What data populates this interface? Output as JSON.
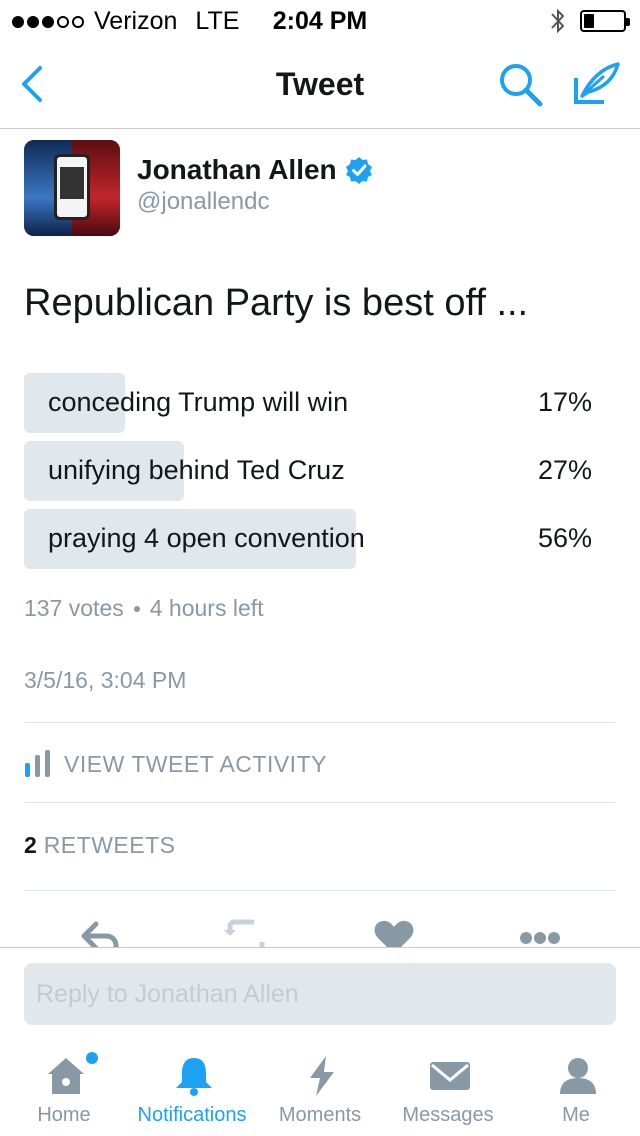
{
  "status_bar": {
    "carrier": "Verizon",
    "network": "LTE",
    "time": "2:04 PM",
    "signal_bars_filled": 3,
    "signal_bars_total": 5
  },
  "nav": {
    "title": "Tweet",
    "icons": [
      "chevron-left-icon",
      "search-icon",
      "compose-icon"
    ]
  },
  "tweet": {
    "author": {
      "name": "Jonathan Allen",
      "handle": "@jonallendc",
      "verified": true
    },
    "text": "Republican Party is best off ...",
    "poll": {
      "options": [
        {
          "label": "conceding Trump will win",
          "percent_text": "17%",
          "percent": 17
        },
        {
          "label": "unifying behind Ted Cruz",
          "percent_text": "27%",
          "percent": 27
        },
        {
          "label": "praying 4 open convention",
          "percent_text": "56%",
          "percent": 56
        }
      ],
      "votes": "137 votes",
      "time_left": "4 hours left"
    },
    "timestamp": "3/5/16, 3:04 PM",
    "activity_label": "VIEW TWEET ACTIVITY",
    "retweets_count": "2",
    "retweets_label": "RETWEETS"
  },
  "reply": {
    "placeholder": "Reply to Jonathan Allen"
  },
  "tabbar": {
    "items": [
      {
        "label": "Home",
        "icon": "home-icon",
        "active": false
      },
      {
        "label": "Notifications",
        "icon": "bell-icon",
        "active": true
      },
      {
        "label": "Moments",
        "icon": "lightning-icon",
        "active": false
      },
      {
        "label": "Messages",
        "icon": "envelope-icon",
        "active": false
      },
      {
        "label": "Me",
        "icon": "person-icon",
        "active": false
      }
    ]
  },
  "colors": {
    "accent": "#1da1f2",
    "muted": "#8899a6",
    "poll_bar": "#e1e8ed"
  }
}
